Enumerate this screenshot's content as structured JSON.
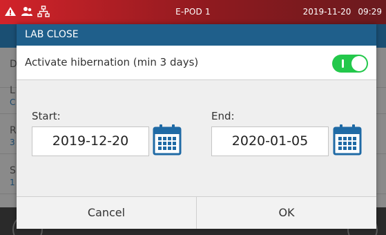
{
  "statusbar": {
    "title": "E-POD 1",
    "date": "2019-11-20",
    "time": "09:29"
  },
  "background": {
    "rows": [
      {
        "l1": "L",
        "l2": "C"
      },
      {
        "l1": "R",
        "l2": "3"
      },
      {
        "l1": "S",
        "l2": "1"
      }
    ],
    "header_letter": "D"
  },
  "dialog": {
    "title": "LAB CLOSE",
    "activate_label": "Activate hibernation (min 3 days)",
    "start_label": "Start:",
    "start_value": "2019-12-20",
    "end_label": "End:",
    "end_value": "2020-01-05",
    "cancel_label": "Cancel",
    "ok_label": "OK"
  },
  "colors": {
    "header_blue": "#1f5f8b",
    "toggle_green": "#23c84b",
    "status_red": "#d2232a",
    "calendar_blue": "#1f6aa5"
  },
  "icons": [
    "warning-icon",
    "users-icon",
    "network-icon",
    "calendar-icon"
  ]
}
